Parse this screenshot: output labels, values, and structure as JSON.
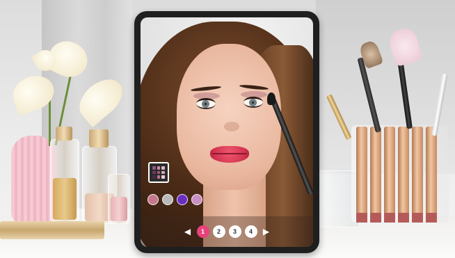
{
  "pagination": {
    "prev_icon": "chevron-left-icon",
    "next_icon": "chevron-right-icon",
    "prev_glyph": "◀",
    "next_glyph": "▶",
    "pages": [
      "1",
      "2",
      "3",
      "4"
    ],
    "active_page": 1,
    "active_color": "#e9417c"
  },
  "palette_button": {
    "icon": "eyeshadow-palette-icon",
    "colors": [
      "#8e5a7a",
      "#c98aa8",
      "#e0b3c6",
      "#6d3d5c",
      "#a3577f",
      "#d8a6bb",
      "#4b2a40",
      "#b37492",
      "#f0cad9"
    ]
  },
  "swatches": [
    {
      "color": "#c4798a"
    },
    {
      "color": "#b9b9b9"
    },
    {
      "color": "#6a2fc0"
    },
    {
      "color": "#c88fc2"
    }
  ]
}
